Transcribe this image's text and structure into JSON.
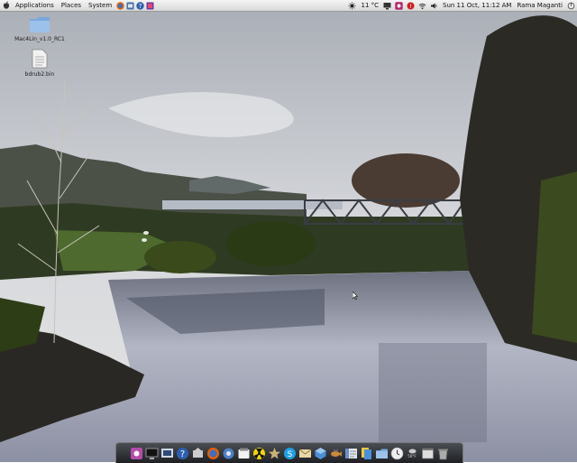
{
  "top_panel": {
    "menus": [
      "Applications",
      "Places",
      "System"
    ],
    "weather": "11 °C",
    "datetime": "Sun 11 Oct, 11:12 AM",
    "user": "Rama Maganti"
  },
  "desktop": {
    "icons": [
      {
        "label": "Mac4Lin_v1.0_RC1",
        "icon": "folder-icon"
      },
      {
        "label": "bdrub2.bin",
        "icon": "file-icon"
      }
    ]
  },
  "dock": {
    "items": [
      "app-launcher-icon",
      "terminal-icon",
      "screenshot-icon",
      "help-icon",
      "unmount-icon",
      "firefox-icon",
      "settings-icon",
      "software-icon",
      "nuclear-icon",
      "bookmark-icon",
      "skype-icon",
      "mail-icon",
      "virtualbox-icon",
      "fish-icon",
      "file-manager-icon",
      "documents-icon",
      "folder-icon",
      "clock-icon",
      "weather-icon",
      "window-icon",
      "trash-icon"
    ],
    "weather_temp": "50°F"
  },
  "colors": {
    "panel_bg": "#e6e6e6",
    "dock_bg": "#2b2d31",
    "sky": "#c9ccd2",
    "water": "#a4a8b8"
  }
}
